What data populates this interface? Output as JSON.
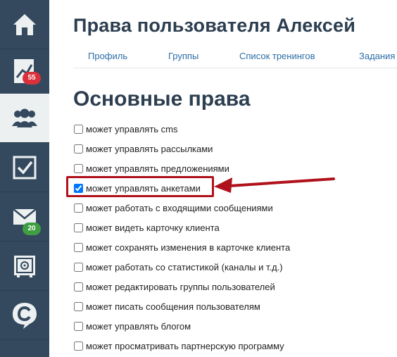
{
  "sidebar": {
    "items": [
      {
        "name": "home",
        "icon": "home-icon"
      },
      {
        "name": "stats",
        "icon": "chart-icon",
        "badge": "55"
      },
      {
        "name": "users",
        "icon": "users-icon",
        "active": true
      },
      {
        "name": "tasks",
        "icon": "checkbox-icon"
      },
      {
        "name": "messages",
        "icon": "envelope-icon",
        "badge": "20"
      },
      {
        "name": "safe",
        "icon": "safe-icon"
      },
      {
        "name": "brand",
        "icon": "c-logo-icon"
      }
    ],
    "colors": {
      "bg": "#34495e",
      "active_bg": "#ecf0f1",
      "badge_red": "#d9303b",
      "badge_green": "#3e9e41"
    }
  },
  "page": {
    "title": "Права пользователя Алексей",
    "tabs": [
      "Профиль",
      "Группы",
      "Список тренингов",
      "Задания"
    ],
    "section_title": "Основные права"
  },
  "permissions": [
    {
      "label": "может управлять cms",
      "checked": false
    },
    {
      "label": "может управлять рассылками",
      "checked": false
    },
    {
      "label": "может управлять предложениями",
      "checked": false
    },
    {
      "label": "может управлять анкетами",
      "checked": true
    },
    {
      "label": "может работать с входящими сообщениями",
      "checked": false
    },
    {
      "label": "может видеть карточку клиента",
      "checked": false
    },
    {
      "label": "может сохранять изменения в карточке клиента",
      "checked": false
    },
    {
      "label": "может работать со статистикой (каналы и т.д.)",
      "checked": false
    },
    {
      "label": "может редактировать группы пользователей",
      "checked": false
    },
    {
      "label": "может писать сообщения пользователям",
      "checked": false
    },
    {
      "label": "может управлять блогом",
      "checked": false
    },
    {
      "label": "может просматривать партнерскую программу",
      "checked": false
    }
  ],
  "annotation": {
    "color": "#b0121b",
    "highlighted": "может управлять анкетами"
  }
}
